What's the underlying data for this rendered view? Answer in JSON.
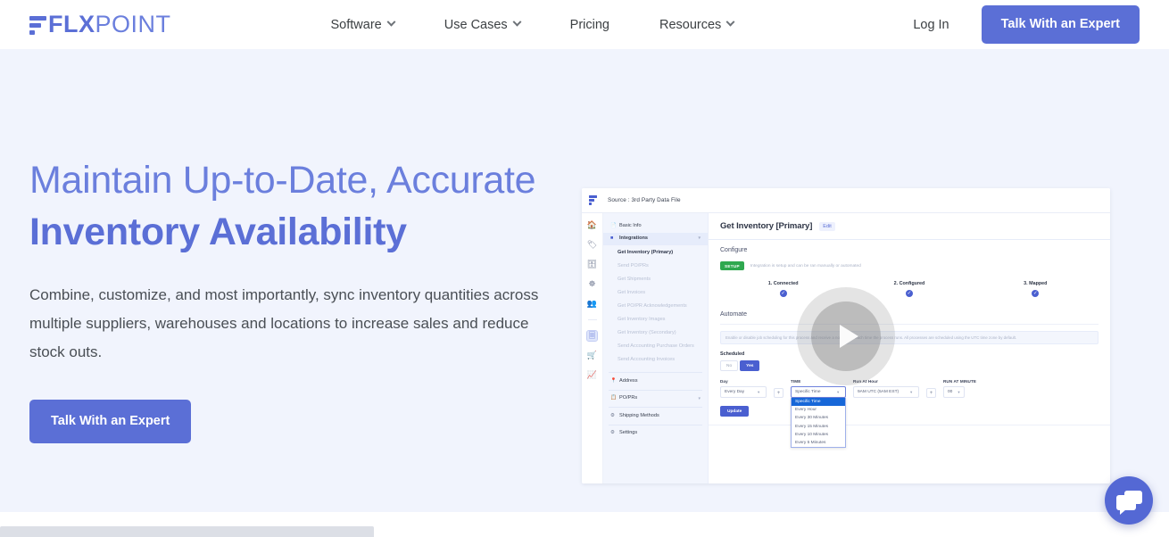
{
  "header": {
    "logo": {
      "flx": "FLX",
      "point": "POINT",
      "mark": "flxpoint-logo-mark"
    },
    "nav": [
      {
        "label": "Software",
        "has_caret": true
      },
      {
        "label": "Use Cases",
        "has_caret": true
      },
      {
        "label": "Pricing",
        "has_caret": false
      },
      {
        "label": "Resources",
        "has_caret": true
      }
    ],
    "login_label": "Log In",
    "cta_label": "Talk With an Expert"
  },
  "hero": {
    "title_line1": "Maintain Up-to-Date, Accurate",
    "title_line2": "Inventory Availability",
    "subtitle": "Combine, customize, and most importantly, sync inventory quantities across multiple suppliers, warehouses and locations to increase sales and reduce stock outs.",
    "cta_label": "Talk With an Expert",
    "background_color": "#f1f4fd",
    "accent_color": "#5b6fd6",
    "title_color": "#6b7fdd"
  },
  "media": {
    "play_button": "play-icon",
    "app": {
      "topbar": {
        "source_text": "Source :  3rd Party Data File"
      },
      "rail_icons": [
        "home-icon",
        "tag-icon",
        "inbox-icon",
        "sync-icon",
        "users-icon",
        "document-icon",
        "cart-icon",
        "analytics-icon"
      ],
      "menu": [
        {
          "label": "Basic Info",
          "icon": "file-icon"
        },
        {
          "label": "Integrations",
          "icon": "grid-icon",
          "section": true,
          "chevron": "chevron-up-icon"
        }
      ],
      "integration_items": [
        "Get Inventory (Primary)",
        "Send PO/PRs",
        "Get Shipments",
        "Get Invoices",
        "Get PO/PR Acknowledgements",
        "Get Inventory Images",
        "Get Inventory (Secondary)",
        "Send Accounting Purchase Orders",
        "Send Accounting Invoices"
      ],
      "menu_tail": [
        {
          "label": "Address",
          "icon": "pin-icon"
        },
        {
          "label": "PO/PRs",
          "icon": "doc-icon",
          "chevron": "chevron-down-icon"
        },
        {
          "label": "Shipping Methods",
          "icon": "gear-icon"
        },
        {
          "label": "Settings",
          "icon": "sliders-icon"
        }
      ],
      "panel": {
        "title": "Get Inventory [Primary]",
        "edit_label": "Edit",
        "configure_label": "Configure",
        "setup_badge": "SETUP",
        "setup_note": "Integration is setup and can be ran manually or automated",
        "steps": [
          {
            "label": "1. Connected",
            "state": "check-icon"
          },
          {
            "label": "2. Configured",
            "state": "check-icon"
          },
          {
            "label": "3. Mapped",
            "state": "check-icon"
          }
        ],
        "automate_label": "Automate",
        "info_text": "Enable or disable job scheduling for this process and receive a notification each time the process runs. All processes are scheduled using the UTC time zone by default.",
        "scheduled_label": "Scheduled",
        "toggle_no": "No",
        "toggle_yes": "Yes",
        "fields": [
          {
            "label": "Day",
            "value": "Every Day"
          },
          {
            "label": "TIME",
            "value": "Specific Time"
          },
          {
            "label": "Run At Hour",
            "value": "9AM UTC (5AM EST)"
          },
          {
            "label": "RUN AT MINUTE",
            "value": "00"
          }
        ],
        "dropdown_options": [
          "Specific Time",
          "Every Hour",
          "Every 30 Minutes",
          "Every 15 Minutes",
          "Every 10 Minutes",
          "Every 5 Minutes"
        ],
        "update_label": "Update",
        "plus_label": "+"
      }
    }
  },
  "chat": {
    "icon": "chat-bubbles-icon",
    "color": "#5468d4"
  }
}
